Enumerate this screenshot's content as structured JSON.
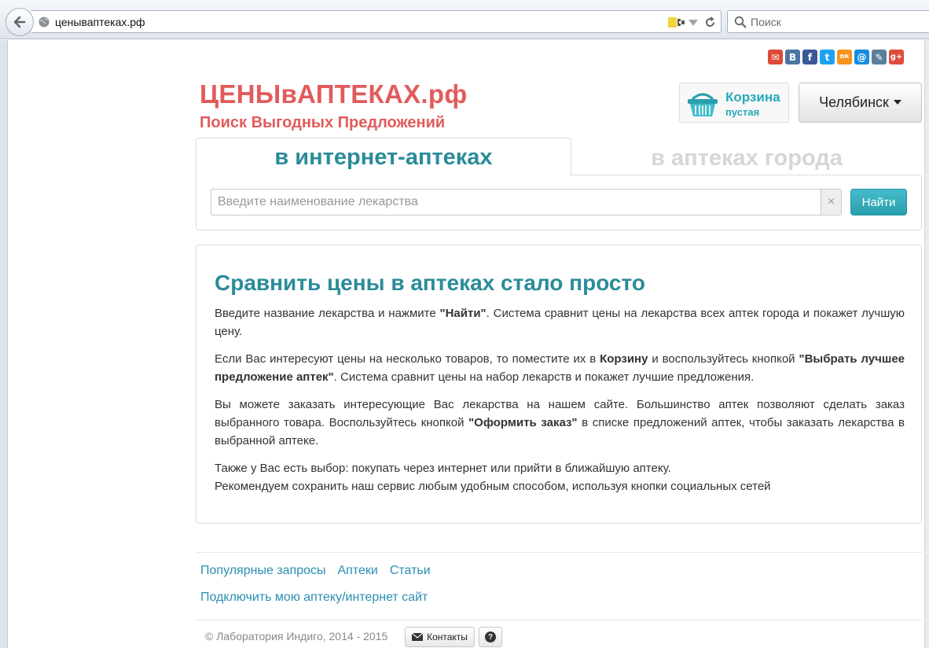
{
  "browser": {
    "url": "ценываптеках.рф",
    "search_placeholder": "Поиск"
  },
  "social": [
    {
      "name": "Gmail",
      "glyph": "✉",
      "color": "#dd4b39"
    },
    {
      "name": "ВКонтакте",
      "glyph": "В",
      "color": "#4c75a3"
    },
    {
      "name": "Facebook",
      "glyph": "f",
      "color": "#3b5998"
    },
    {
      "name": "Twitter",
      "glyph": "t",
      "color": "#1da1f2"
    },
    {
      "name": "Одноклассники",
      "glyph": "ок",
      "color": "#f7931e"
    },
    {
      "name": "Мой Мир",
      "glyph": "@",
      "color": "#168de2"
    },
    {
      "name": "LiveJournal",
      "glyph": "✎",
      "color": "#5c7f9c"
    },
    {
      "name": "Google+",
      "glyph": "g+",
      "color": "#dd4b39"
    }
  ],
  "header": {
    "logo_title": "ЦЕНЫвАПТЕКАХ.рф",
    "logo_subtitle": "Поиск Выгодных Предложений",
    "cart_title": "Корзина",
    "cart_status": "пустая",
    "city": "Челябинск"
  },
  "tabs": {
    "online": "в интернет-аптеках",
    "city": "в аптеках города"
  },
  "search": {
    "placeholder": "Введите наименование лекарства",
    "clear": "×",
    "button": "Найти"
  },
  "info": {
    "heading": "Сравнить цены в аптеках стало просто",
    "p1_a": "Введите название лекарства и нажмите ",
    "p1_b": "\"Найти\"",
    "p1_c": ". Система сравнит цены на лекарства всех аптек города и покажет лучшую цену.",
    "p2_a": "Если Вас интересуют цены на несколько товаров, то поместите их в ",
    "p2_b": "Корзину",
    "p2_c": " и воспользуйтесь кнопкой ",
    "p2_d": "\"Выбрать лучшее предложение аптек\"",
    "p2_e": ". Система сравнит цены на набор лекарств и покажет лучшие предложения.",
    "p3_a": "Вы можете заказать интересующие Вас лекарства на нашем сайте. Большинство аптек позволяют сделать заказ выбранного товара. Воспользуйтесь кнопкой ",
    "p3_b": "\"Оформить заказ\"",
    "p3_c": " в списке предложений аптек, чтобы заказать лекарства в выбранной аптеке.",
    "p4_line1": "Также у Вас есть выбор: покупать через интернет или прийти в ближайшую аптеку.",
    "p4_line2": "Рекомендуем сохранить наш сервис любым удобным способом, используя кнопки социальных сетей"
  },
  "footer": {
    "link_popular": "Популярные запросы",
    "link_pharmacies": "Аптеки",
    "link_articles": "Статьи",
    "link_connect": "Подключить мою аптеку/интернет сайт",
    "copyright": "© Лаборатория Индиго, 2014 - 2015",
    "contacts": "Контакты",
    "help": "?"
  },
  "colors": {
    "brand_red": "#e25b5b",
    "accent_teal": "#2a8c99",
    "link_blue": "#2a8fb2"
  }
}
